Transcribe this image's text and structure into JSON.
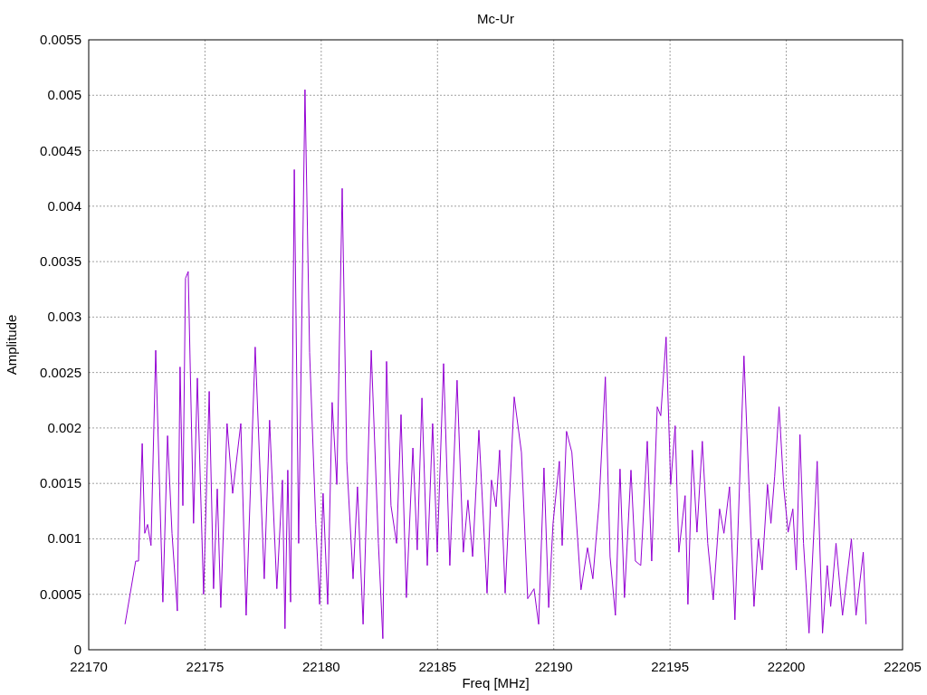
{
  "chart_data": {
    "type": "line",
    "grid": true,
    "title": "Mc-Ur",
    "xlabel": "Freq [MHz]",
    "ylabel": "Amplitude",
    "xlim": [
      22170,
      22205
    ],
    "ylim": [
      0,
      0.0055
    ],
    "xticks": [
      22170,
      22175,
      22180,
      22185,
      22190,
      22195,
      22200,
      22205
    ],
    "yticks": [
      0,
      0.0005,
      0.001,
      0.0015,
      0.002,
      0.0025,
      0.003,
      0.0035,
      0.004,
      0.0045,
      0.005,
      0.0055
    ],
    "x": [
      22171.56,
      22172.02,
      22172.14,
      22172.3,
      22172.41,
      22172.53,
      22172.68,
      22172.88,
      22173.19,
      22173.39,
      22173.58,
      22173.81,
      22173.93,
      22174.05,
      22174.16,
      22174.28,
      22174.51,
      22174.67,
      22174.94,
      22175.18,
      22175.37,
      22175.53,
      22175.68,
      22175.95,
      22176.19,
      22176.54,
      22176.77,
      22177.16,
      22177.55,
      22177.78,
      22178.09,
      22178.33,
      22178.44,
      22178.56,
      22178.68,
      22178.84,
      22179.03,
      22179.3,
      22179.5,
      22179.77,
      22179.93,
      22180.08,
      22180.28,
      22180.47,
      22180.67,
      22180.9,
      22181.1,
      22181.37,
      22181.56,
      22181.8,
      22182.15,
      22182.46,
      22182.65,
      22182.81,
      22183.0,
      22183.24,
      22183.43,
      22183.66,
      22183.94,
      22184.13,
      22184.33,
      22184.56,
      22184.79,
      22184.99,
      22185.26,
      22185.53,
      22185.84,
      22186.11,
      22186.31,
      22186.51,
      22186.78,
      22187.13,
      22187.32,
      22187.52,
      22187.67,
      22187.91,
      22188.3,
      22188.61,
      22188.88,
      22189.15,
      22189.35,
      22189.58,
      22189.78,
      22189.97,
      22190.24,
      22190.36,
      22190.55,
      22190.78,
      22191.17,
      22191.45,
      22191.68,
      22191.95,
      22192.22,
      22192.42,
      22192.65,
      22192.85,
      22193.04,
      22193.32,
      22193.51,
      22193.74,
      22194.02,
      22194.21,
      22194.45,
      22194.6,
      22194.83,
      22195.03,
      22195.22,
      22195.38,
      22195.65,
      22195.77,
      22195.96,
      22196.16,
      22196.39,
      22196.62,
      22196.86,
      22197.13,
      22197.32,
      22197.56,
      22197.79,
      22198.18,
      22198.41,
      22198.61,
      22198.8,
      22198.96,
      22199.19,
      22199.34,
      22199.5,
      22199.69,
      22199.89,
      22200.08,
      22200.28,
      22200.43,
      22200.59,
      22200.74,
      22200.98,
      22201.33,
      22201.56,
      22201.76,
      22201.91,
      22202.14,
      22202.42,
      22202.8,
      22203.0,
      22203.31,
      22203.43
    ],
    "series": [
      {
        "color": "#9400d3",
        "values": [
          0.00023,
          0.0008,
          0.0008,
          0.00186,
          0.00105,
          0.00113,
          0.00094,
          0.0027,
          0.00043,
          0.00193,
          0.00105,
          0.00035,
          0.00255,
          0.0013,
          0.00335,
          0.00341,
          0.00114,
          0.00245,
          0.0005,
          0.00233,
          0.00055,
          0.00145,
          0.00038,
          0.00204,
          0.00141,
          0.00204,
          0.00031,
          0.00273,
          0.00064,
          0.00207,
          0.00055,
          0.00153,
          0.00019,
          0.00162,
          0.00043,
          0.00433,
          0.00096,
          0.00505,
          0.00268,
          0.00113,
          0.00041,
          0.00141,
          0.00041,
          0.00223,
          0.00149,
          0.00416,
          0.0017,
          0.00064,
          0.00147,
          0.00023,
          0.0027,
          0.00096,
          0.0001,
          0.0026,
          0.0013,
          0.00096,
          0.00212,
          0.00047,
          0.00182,
          0.0009,
          0.00227,
          0.00076,
          0.00204,
          0.00088,
          0.00258,
          0.00076,
          0.00243,
          0.00088,
          0.00135,
          0.00084,
          0.00198,
          0.00051,
          0.00153,
          0.00129,
          0.0018,
          0.00051,
          0.00228,
          0.00178,
          0.00046,
          0.00055,
          0.00023,
          0.00164,
          0.00038,
          0.00114,
          0.0017,
          0.00094,
          0.00197,
          0.00178,
          0.00054,
          0.00092,
          0.00064,
          0.00133,
          0.00246,
          0.00084,
          0.00031,
          0.00163,
          0.00047,
          0.00162,
          0.0008,
          0.00076,
          0.00188,
          0.0008,
          0.00219,
          0.00211,
          0.00282,
          0.00149,
          0.00202,
          0.00088,
          0.00139,
          0.00041,
          0.0018,
          0.00106,
          0.00188,
          0.00096,
          0.00045,
          0.00127,
          0.00105,
          0.00147,
          0.00027,
          0.00265,
          0.00141,
          0.00039,
          0.001,
          0.00072,
          0.00149,
          0.00114,
          0.00156,
          0.00219,
          0.00147,
          0.00106,
          0.00127,
          0.00072,
          0.00194,
          0.00096,
          0.00015,
          0.0017,
          0.00015,
          0.00076,
          0.00039,
          0.00096,
          0.00031,
          0.001,
          0.00031,
          0.00088,
          0.00023
        ]
      }
    ]
  }
}
